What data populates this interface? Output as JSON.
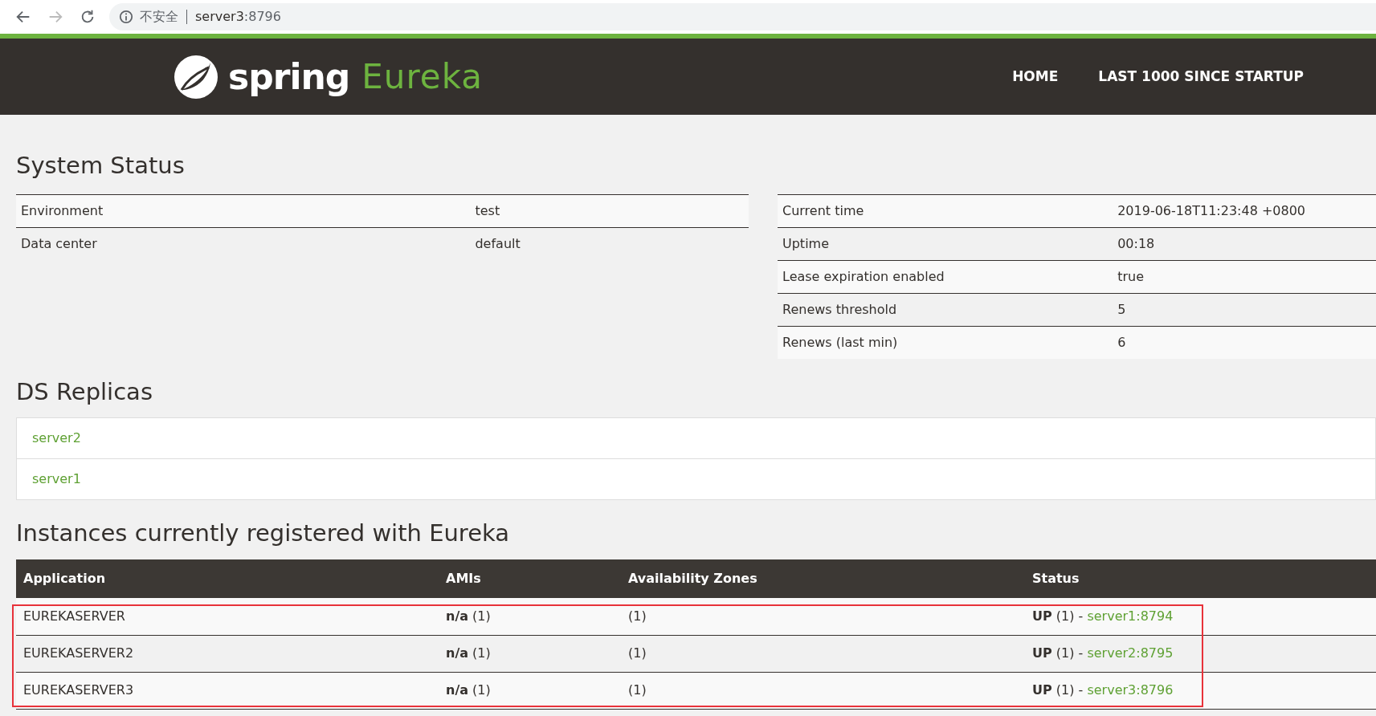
{
  "browser": {
    "security_label": "不安全",
    "url_host": "server3",
    "url_port": ":8796"
  },
  "header": {
    "brand_word": "spring",
    "brand_product": "Eureka",
    "nav": [
      {
        "label": "HOME"
      },
      {
        "label": "LAST 1000 SINCE STARTUP"
      }
    ]
  },
  "system_status": {
    "title": "System Status",
    "left_table": [
      {
        "name": "Environment",
        "value": "test"
      },
      {
        "name": "Data center",
        "value": "default"
      }
    ],
    "right_table": [
      {
        "name": "Current time",
        "value": "2019-06-18T11:23:48 +0800"
      },
      {
        "name": "Uptime",
        "value": "00:18"
      },
      {
        "name": "Lease expiration enabled",
        "value": "true"
      },
      {
        "name": "Renews threshold",
        "value": "5"
      },
      {
        "name": "Renews (last min)",
        "value": "6"
      }
    ]
  },
  "ds_replicas": {
    "title": "DS Replicas",
    "items": [
      {
        "label": "server2"
      },
      {
        "label": "server1"
      }
    ]
  },
  "instances": {
    "title": "Instances currently registered with Eureka",
    "columns": [
      "Application",
      "AMIs",
      "Availability Zones",
      "Status"
    ],
    "rows": [
      {
        "application": "EUREKASERVER",
        "amis": "**n/a** (1)",
        "zones": "(1)",
        "status": "**UP** (1) - ",
        "instance_link": "server1:8794"
      },
      {
        "application": "EUREKASERVER2",
        "amis": "**n/a** (1)",
        "zones": "(1)",
        "status": "**UP** (1) - ",
        "instance_link": "server2:8795"
      },
      {
        "application": "EUREKASERVER3",
        "amis": "**n/a** (1)",
        "zones": "(1)",
        "status": "**UP** (1) - ",
        "instance_link": "server3:8796"
      }
    ],
    "highlighted": true
  }
}
